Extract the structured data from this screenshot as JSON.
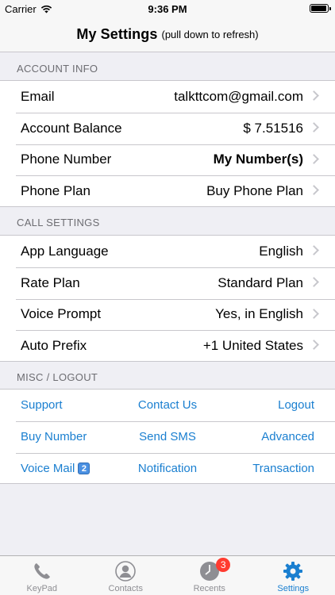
{
  "status_bar": {
    "carrier": "Carrier",
    "time": "9:36 PM"
  },
  "nav": {
    "title": "My Settings",
    "subtitle": "(pull down to refresh)"
  },
  "sections": {
    "account": {
      "header": "ACCOUNT INFO",
      "rows": [
        {
          "label": "Email",
          "value": "talkttcom@gmail.com"
        },
        {
          "label": "Account Balance",
          "value": "$ 7.51516"
        },
        {
          "label": "Phone Number",
          "value": "My Number(s)"
        },
        {
          "label": "Phone Plan",
          "value": "Buy Phone Plan"
        }
      ]
    },
    "call": {
      "header": "CALL SETTINGS",
      "rows": [
        {
          "label": "App Language",
          "value": "English"
        },
        {
          "label": "Rate Plan",
          "value": "Standard Plan"
        },
        {
          "label": "Voice Prompt",
          "value": "Yes, in English"
        },
        {
          "label": "Auto Prefix",
          "value": "+1 United States"
        }
      ]
    },
    "misc": {
      "header": "MISC / LOGOUT",
      "rows": [
        [
          "Support",
          "Contact Us",
          "Logout"
        ],
        [
          "Buy Number",
          "Send SMS",
          "Advanced"
        ],
        [
          "Voice Mail",
          "Notification",
          "Transaction"
        ]
      ],
      "voicemail_badge": "2"
    }
  },
  "tabs": [
    {
      "label": "KeyPad",
      "icon": "phone-icon"
    },
    {
      "label": "Contacts",
      "icon": "contact-icon"
    },
    {
      "label": "Recents",
      "icon": "clock-icon",
      "badge": "3"
    },
    {
      "label": "Settings",
      "icon": "gear-icon",
      "active": true
    }
  ],
  "colors": {
    "accent": "#1a7fd0",
    "badge": "#ff3b30",
    "background": "#efeff4"
  }
}
